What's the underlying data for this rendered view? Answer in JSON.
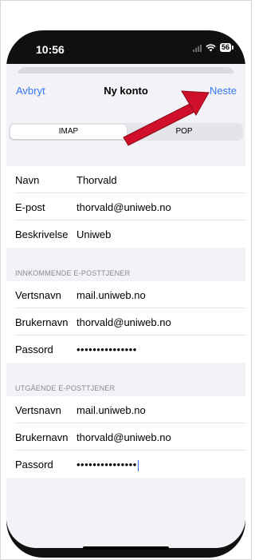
{
  "status_bar": {
    "time": "10:56",
    "battery": "56"
  },
  "nav": {
    "cancel": "Avbryt",
    "title": "Ny konto",
    "next": "Neste"
  },
  "segment": {
    "options": [
      "IMAP",
      "POP"
    ],
    "selected": "IMAP"
  },
  "account": [
    {
      "label": "Navn",
      "value": "Thorvald"
    },
    {
      "label": "E-post",
      "value": "thorvald@uniweb.no"
    },
    {
      "label": "Beskrivelse",
      "value": "Uniweb"
    }
  ],
  "incoming": {
    "header": "INNKOMMENDE E-POSTTJENER",
    "rows": [
      {
        "label": "Vertsnavn",
        "value": "mail.uniweb.no"
      },
      {
        "label": "Brukernavn",
        "value": "thorvald@uniweb.no"
      },
      {
        "label": "Passord",
        "value": "•••••••••••••••"
      }
    ]
  },
  "outgoing": {
    "header": "UTGÅENDE E-POSTTJENER",
    "rows": [
      {
        "label": "Vertsnavn",
        "value": "mail.uniweb.no"
      },
      {
        "label": "Brukernavn",
        "value": "thorvald@uniweb.no"
      },
      {
        "label": "Passord",
        "value": "•••••••••••••••"
      }
    ]
  },
  "colors": {
    "accent": "#3478f6",
    "arrow": "#d0102a"
  }
}
